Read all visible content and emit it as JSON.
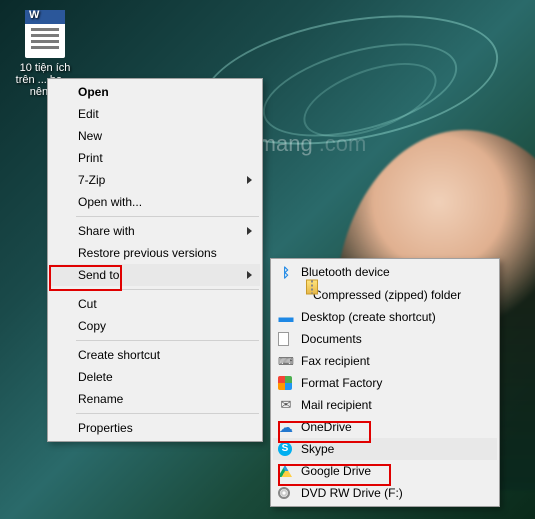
{
  "desktop_file": {
    "label": "10 tiện ích trên ... ba ... nên ..."
  },
  "watermark": "uantrimang",
  "context_menu": {
    "open": "Open",
    "edit": "Edit",
    "new": "New",
    "print": "Print",
    "sevenzip": "7-Zip",
    "open_with": "Open with...",
    "share_with": "Share with",
    "restore": "Restore previous versions",
    "send_to": "Send to",
    "cut": "Cut",
    "copy": "Copy",
    "create_shortcut": "Create shortcut",
    "delete": "Delete",
    "rename": "Rename",
    "properties": "Properties"
  },
  "send_to_menu": {
    "bluetooth": "Bluetooth device",
    "compressed": "Compressed (zipped) folder",
    "desktop": "Desktop (create shortcut)",
    "documents": "Documents",
    "fax": "Fax recipient",
    "format_factory": "Format Factory",
    "mail": "Mail recipient",
    "onedrive": "OneDrive",
    "skype": "Skype",
    "google_drive": "Google Drive",
    "dvd": "DVD RW Drive (F:)"
  },
  "highlights": [
    "send_to",
    "onedrive",
    "google_drive"
  ]
}
